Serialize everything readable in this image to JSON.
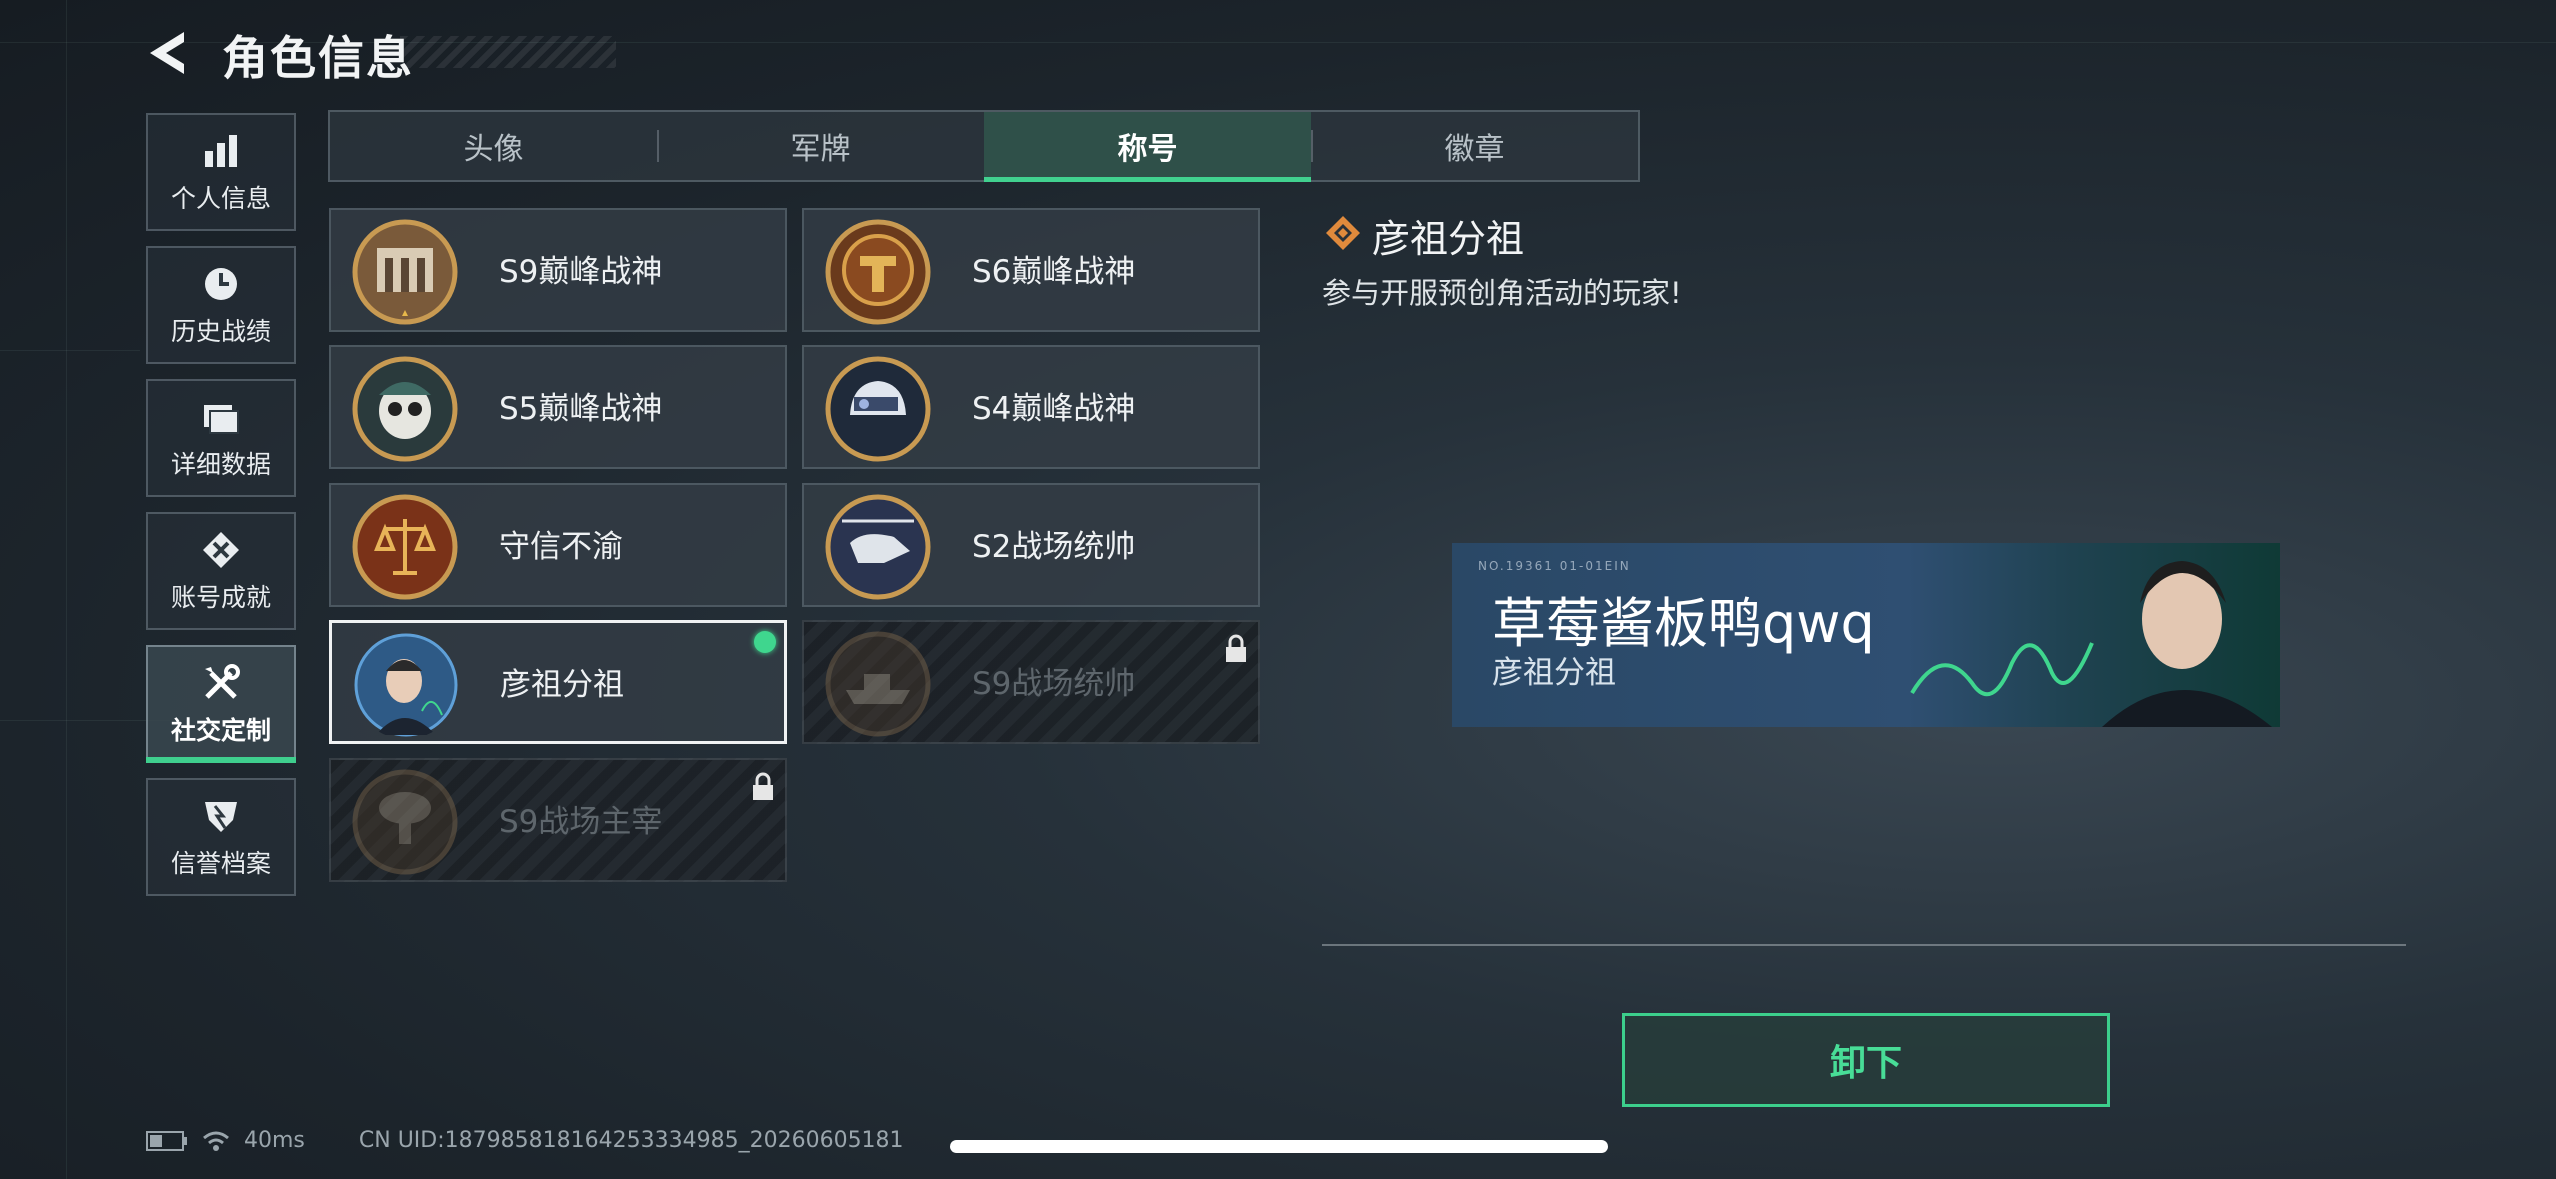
{
  "header": {
    "title": "角色信息"
  },
  "nav": [
    {
      "label": "个人信息",
      "icon": "bar-chart-icon",
      "active": false
    },
    {
      "label": "历史战绩",
      "icon": "clock-icon",
      "active": false
    },
    {
      "label": "详细数据",
      "icon": "folder-icon",
      "active": false
    },
    {
      "label": "账号成就",
      "icon": "medal-icon",
      "active": false
    },
    {
      "label": "社交定制",
      "icon": "tools-icon",
      "active": true
    },
    {
      "label": "信誉档案",
      "icon": "shield-icon",
      "active": false
    }
  ],
  "tabs": [
    {
      "label": "头像",
      "active": false
    },
    {
      "label": "军牌",
      "active": false
    },
    {
      "label": "称号",
      "active": true
    },
    {
      "label": "徽章",
      "active": false
    }
  ],
  "titles": [
    {
      "name": "S9巅峰战神",
      "locked": false,
      "selected": false,
      "emblem": "fortress-emblem-icon"
    },
    {
      "name": "S6巅峰战神",
      "locked": false,
      "selected": false,
      "emblem": "t-shield-emblem-icon"
    },
    {
      "name": "S5巅峰战神",
      "locked": false,
      "selected": false,
      "emblem": "skull-helmet-emblem-icon"
    },
    {
      "name": "S4巅峰战神",
      "locked": false,
      "selected": false,
      "emblem": "night-vision-helmet-emblem-icon"
    },
    {
      "name": "守信不渝",
      "locked": false,
      "selected": false,
      "emblem": "scales-emblem-icon"
    },
    {
      "name": "S2战场统帅",
      "locked": false,
      "selected": false,
      "emblem": "helicopter-emblem-icon"
    },
    {
      "name": "彦祖分祖",
      "locked": false,
      "selected": true,
      "emblem": "portrait-emblem-icon"
    },
    {
      "name": "S9战场统帅",
      "locked": true,
      "selected": false,
      "emblem": "warship-emblem-icon"
    },
    {
      "name": "S9战场主宰",
      "locked": true,
      "selected": false,
      "emblem": "mushroom-cloud-emblem-icon"
    }
  ],
  "detail": {
    "title": "彦祖分祖",
    "description": "参与开服预创角活动的玩家!",
    "banner": {
      "player_name": "草莓酱板鸭qwq",
      "title": "彦祖分祖",
      "code_text": "NO.19361  01-01EIN"
    },
    "unequip_label": "卸下"
  },
  "footer": {
    "ping": "40ms",
    "uid": "CN UID:1879858181642533349​85_20260605181"
  },
  "colors": {
    "accent": "#3fcf8e",
    "emblem_gold": "#c89a52",
    "detail_icon": "#e08a3c"
  }
}
